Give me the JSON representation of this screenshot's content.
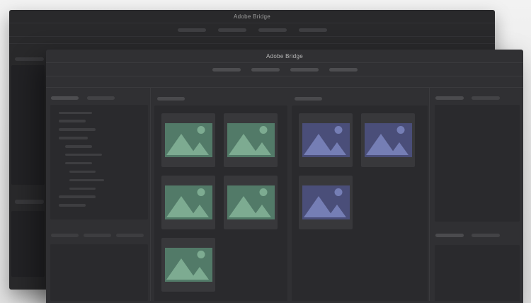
{
  "app": {
    "name": "Adobe Bridge"
  },
  "colors": {
    "desktop_background": "#e8e8e8",
    "front_window_background": "#303033",
    "back_window_background": "#29292b",
    "panel_background": "#2a2a2d",
    "card_background": "#38383b",
    "green_thumbnail_background": "#527a68",
    "green_thumbnail_shapes": "#7dab91",
    "purple_thumbnail_background": "#4a4e79",
    "purple_thumbnail_shapes": "#757eb5"
  },
  "back_window": {
    "title": "Adobe Bridge",
    "toolbar_pill_count": 4
  },
  "front_window": {
    "title": "Adobe Bridge",
    "toolbar_pill_count": 4,
    "left_sidebar": {
      "tab_pill_count": 2,
      "footer_pill_count": 3,
      "tree_lines": [
        {
          "indent": 0,
          "width": 47
        },
        {
          "indent": 0,
          "width": 38
        },
        {
          "indent": 0,
          "width": 52
        },
        {
          "indent": 0,
          "width": 41
        },
        {
          "indent": 1,
          "width": 38
        },
        {
          "indent": 1,
          "width": 52
        },
        {
          "indent": 1,
          "width": 38
        },
        {
          "indent": 2,
          "width": 37
        },
        {
          "indent": 2,
          "width": 49
        },
        {
          "indent": 2,
          "width": 37
        },
        {
          "indent": 0,
          "width": 52
        },
        {
          "indent": 0,
          "width": 38
        }
      ]
    },
    "content_groups": [
      {
        "name": "green-thumbnails",
        "icon": "image-placeholder-icon",
        "thumb_color_bg": "#527a68",
        "thumb_color_shape": "#7dab91",
        "thumbnail_count": 5
      },
      {
        "name": "purple-thumbnails",
        "icon": "image-placeholder-icon",
        "thumb_color_bg": "#4a4e79",
        "thumb_color_shape": "#757eb5",
        "thumbnail_count": 3
      }
    ],
    "right_sidebar": {
      "sections": [
        {
          "pill_count": 2
        },
        {
          "pill_count": 2
        }
      ]
    }
  }
}
